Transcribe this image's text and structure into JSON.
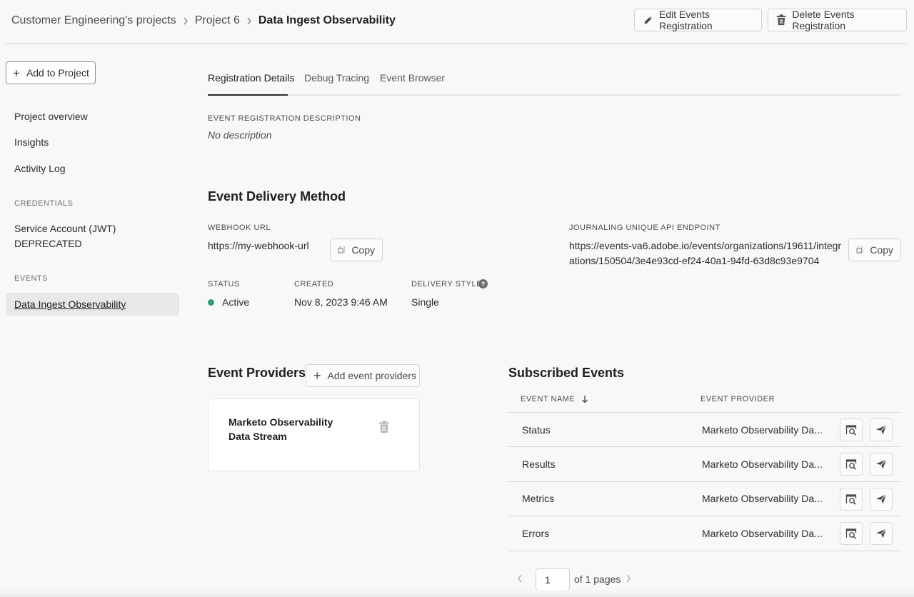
{
  "breadcrumb": {
    "items": [
      "Customer Engineering's projects",
      "Project 6"
    ],
    "current": "Data Ingest Observability"
  },
  "header": {
    "edit_label": "Edit Events Registration",
    "delete_label": "Delete Events Registration"
  },
  "sidebar": {
    "add_project_label": "Add to Project",
    "links": [
      "Project overview",
      "Insights",
      "Activity Log"
    ],
    "credentials_heading": "CREDENTIALS",
    "credential_item": "Service Account (JWT)",
    "credential_status": "DEPRECATED",
    "events_heading": "EVENTS",
    "active_item": "Data Ingest Observability"
  },
  "tabs": [
    "Registration Details",
    "Debug Tracing",
    "Event Browser"
  ],
  "description": {
    "label": "EVENT REGISTRATION DESCRIPTION",
    "value": "No description"
  },
  "delivery": {
    "title": "Event Delivery Method",
    "webhook_label": "WEBHOOK URL",
    "webhook_value": "https://my-webhook-url",
    "copy_label": "Copy",
    "journal_label": "JOURNALING UNIQUE API ENDPOINT",
    "journal_line1": "https://events-va6.adobe.io/events/organizations/19611/integr",
    "journal_line2": "ations/150504/3e4e93cd-ef24-40a1-94fd-63d8c93e9704",
    "status_label": "STATUS",
    "status_value": "Active",
    "created_label": "CREATED",
    "created_value": "Nov 8, 2023 9:46 AM",
    "style_label": "DELIVERY STYLE",
    "style_value": "Single",
    "status_color": "#2d9d78"
  },
  "providers": {
    "title": "Event Providers",
    "add_label": "Add event providers",
    "card_line1": "Marketo Observability",
    "card_line2": "Data Stream"
  },
  "subscribed": {
    "title": "Subscribed Events",
    "col_name": "EVENT NAME",
    "col_provider": "EVENT PROVIDER",
    "rows": [
      {
        "name": "Status",
        "provider": "Marketo Observability Da..."
      },
      {
        "name": "Results",
        "provider": "Marketo Observability Da..."
      },
      {
        "name": "Metrics",
        "provider": "Marketo Observability Da..."
      },
      {
        "name": "Errors",
        "provider": "Marketo Observability Da..."
      }
    ]
  },
  "pagination": {
    "page": "1",
    "of_text": "of 1 pages"
  }
}
